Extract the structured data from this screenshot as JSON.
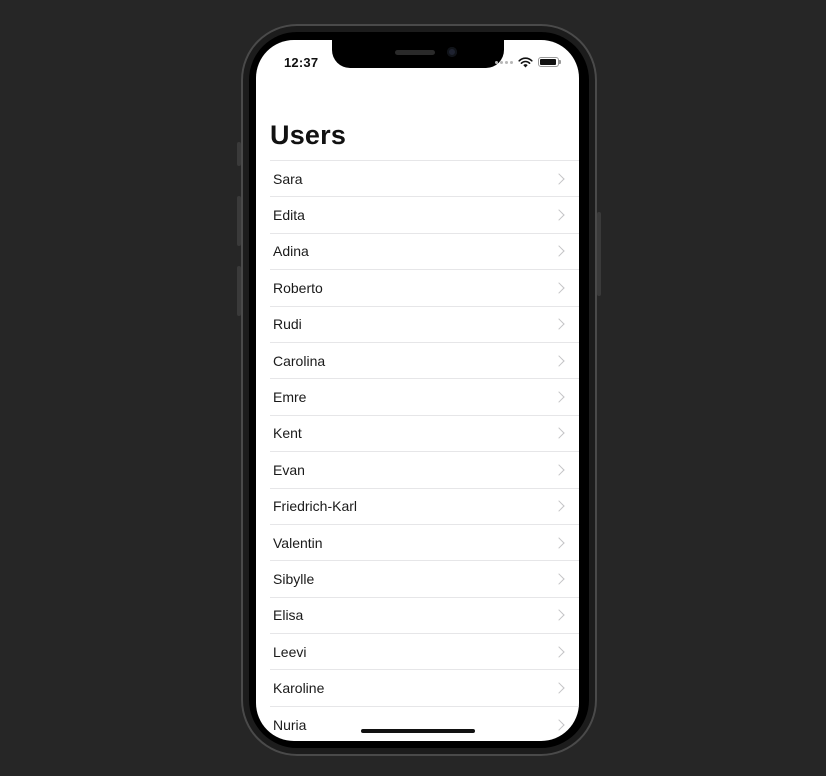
{
  "status_bar": {
    "time": "12:37",
    "icons": [
      "cellular-dots-icon",
      "wifi-icon",
      "battery-icon"
    ]
  },
  "navigation": {
    "title": "Users"
  },
  "users": [
    {
      "name": "Sara"
    },
    {
      "name": "Edita"
    },
    {
      "name": "Adina"
    },
    {
      "name": "Roberto"
    },
    {
      "name": "Rudi"
    },
    {
      "name": "Carolina"
    },
    {
      "name": "Emre"
    },
    {
      "name": "Kent"
    },
    {
      "name": "Evan"
    },
    {
      "name": "Friedrich-Karl"
    },
    {
      "name": "Valentin"
    },
    {
      "name": "Sibylle"
    },
    {
      "name": "Elisa"
    },
    {
      "name": "Leevi"
    },
    {
      "name": "Karoline"
    },
    {
      "name": "Nuria"
    }
  ],
  "colors": {
    "background": "#262626",
    "screen": "#ffffff",
    "separator": "#e6e6e8",
    "chevron": "#c4c4c6",
    "text": "#1a1a1a"
  }
}
